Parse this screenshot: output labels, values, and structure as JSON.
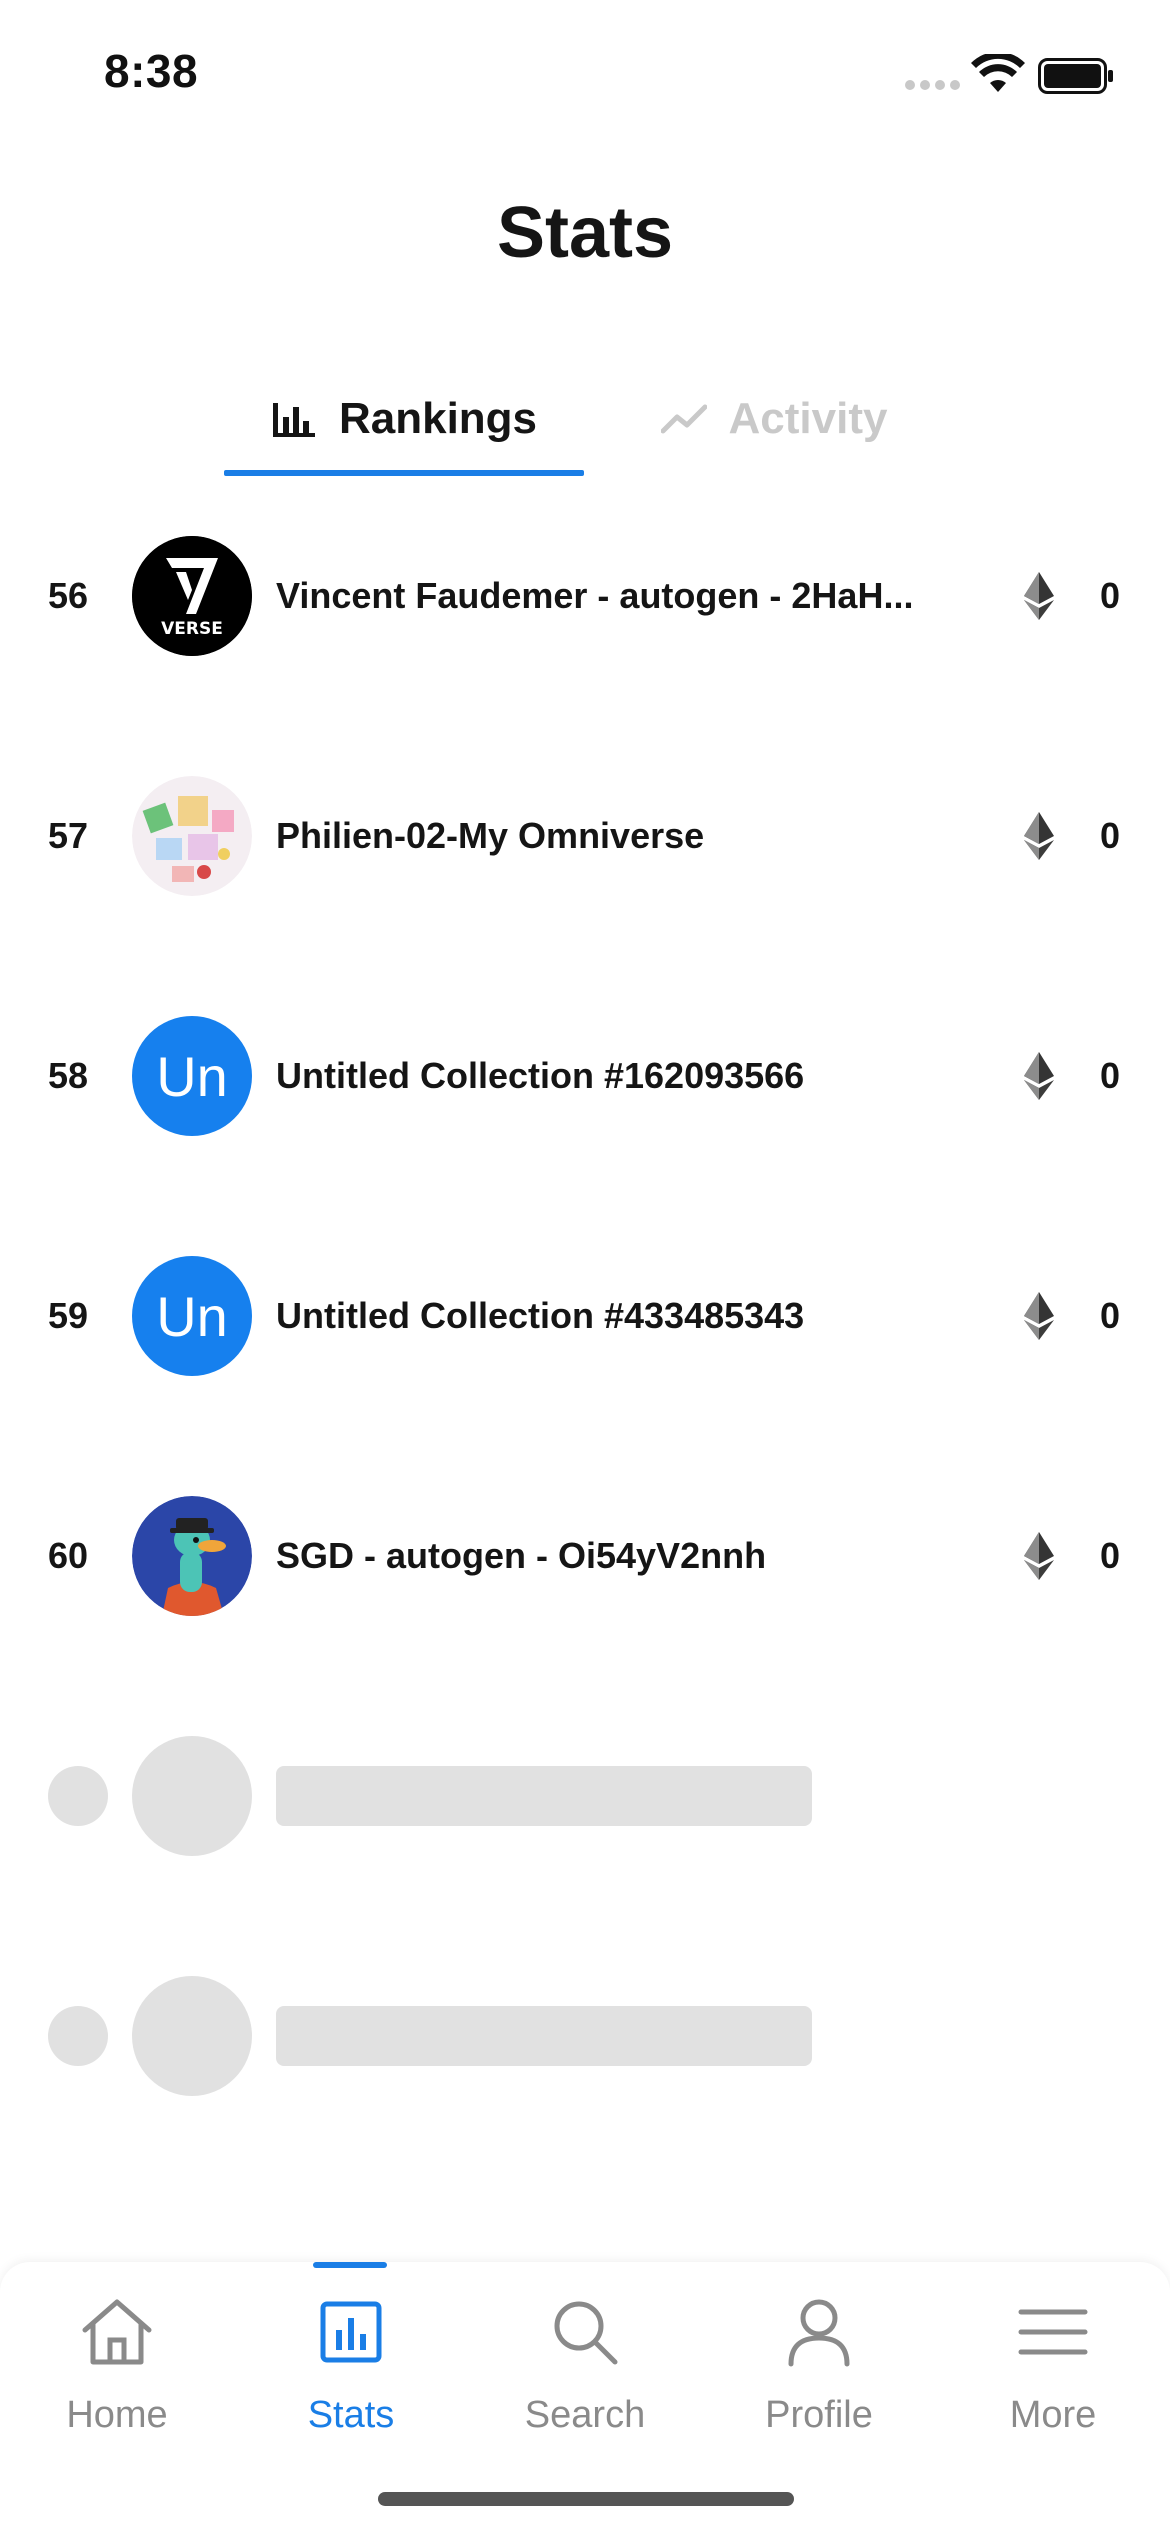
{
  "status_bar": {
    "time": "8:38"
  },
  "header": {
    "title": "Stats"
  },
  "tabs": [
    {
      "label": "Rankings",
      "icon": "bar-chart-icon",
      "active": true
    },
    {
      "label": "Activity",
      "icon": "trend-line-icon",
      "active": false
    }
  ],
  "rankings": [
    {
      "rank": "56",
      "name": "Vincent Faudemer - autogen - 2HaH...",
      "volume": "0",
      "avatar": "verse-logo"
    },
    {
      "rank": "57",
      "name": "Philien-02-My Omniverse",
      "volume": "0",
      "avatar": "collage-image"
    },
    {
      "rank": "58",
      "name": "Untitled Collection #162093566",
      "volume": "0",
      "avatar": "initials",
      "initials": "Un"
    },
    {
      "rank": "59",
      "name": "Untitled Collection #433485343",
      "volume": "0",
      "avatar": "initials",
      "initials": "Un"
    },
    {
      "rank": "60",
      "name": "SGD - autogen - Oi54yV2nnh",
      "volume": "0",
      "avatar": "duck-image"
    }
  ],
  "verse_logo_text": "VERSE",
  "currency_icon": "ethereum-icon",
  "bottom_nav": [
    {
      "label": "Home",
      "icon": "home-icon",
      "active": false
    },
    {
      "label": "Stats",
      "icon": "stats-icon",
      "active": true
    },
    {
      "label": "Search",
      "icon": "search-icon",
      "active": false
    },
    {
      "label": "Profile",
      "icon": "profile-icon",
      "active": false
    },
    {
      "label": "More",
      "icon": "menu-icon",
      "active": false
    }
  ],
  "colors": {
    "accent": "#1a7ee6",
    "initials_avatar": "#1680ee",
    "skeleton": "#e1e1e1",
    "inactive": "#8a8a8a"
  }
}
